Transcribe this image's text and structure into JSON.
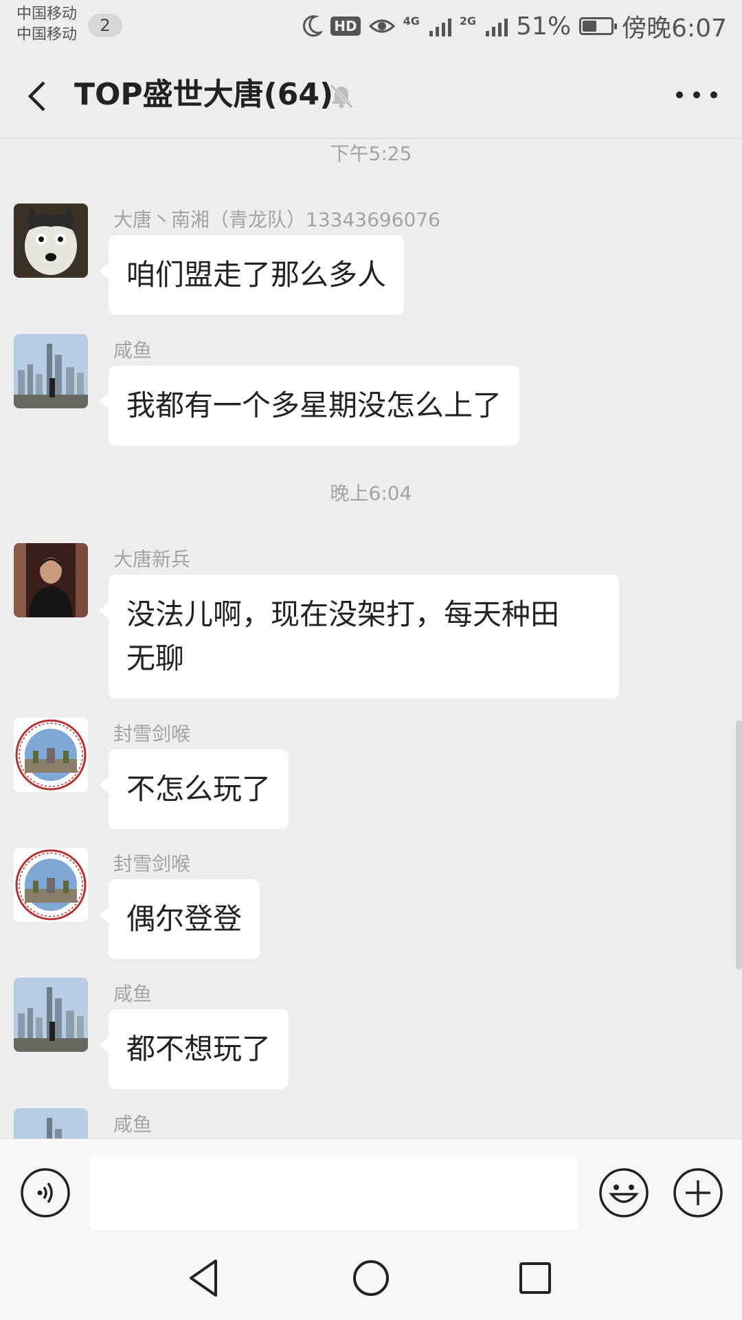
{
  "status_bar": {
    "carrier_1": "中国移动",
    "carrier_2": "中国移动",
    "sim_badge": "2",
    "hd_label": "HD",
    "net_1": "4G",
    "net_2": "2G",
    "battery_percent": "51%",
    "battery_level": 0.51,
    "time": "傍晚6:07"
  },
  "header": {
    "title": "TOP盛世大唐(64)",
    "mute_icon": "bell-muted-icon",
    "more_icon": "more-dots-icon"
  },
  "chat": {
    "timestamps": [
      "下午5:25",
      "晚上6:04"
    ],
    "messages": [
      {
        "sender": "大唐丶南湘（青龙队）13343696076",
        "text": "咱们盟走了那么多人",
        "avatar": "husky-dog-photo"
      },
      {
        "sender": "咸鱼",
        "text": "我都有一个多星期没怎么上了",
        "avatar": "city-skyline-photo"
      },
      {
        "sender": "大唐新兵",
        "text_line_1": "没法儿啊，现在没架打，每天种田",
        "text_line_2": "无聊",
        "avatar": "man-portrait-photo"
      },
      {
        "sender": "封雪剑喉",
        "text": "不怎么玩了",
        "avatar": "university-seal-logo"
      },
      {
        "sender": "封雪剑喉",
        "text": "偶尔登登",
        "avatar": "university-seal-logo"
      },
      {
        "sender": "咸鱼",
        "text": "都不想玩了",
        "avatar": "city-skyline-photo"
      },
      {
        "sender": "咸鱼",
        "avatar": "city-skyline-photo"
      }
    ]
  },
  "input_bar": {
    "voice_icon": "voice-icon",
    "input_value": "",
    "emoji_icon": "emoji-icon",
    "plus_icon": "plus-icon"
  },
  "nav_bar": {
    "back_icon": "nav-back-icon",
    "home_icon": "nav-home-icon",
    "recents_icon": "nav-recents-icon"
  }
}
